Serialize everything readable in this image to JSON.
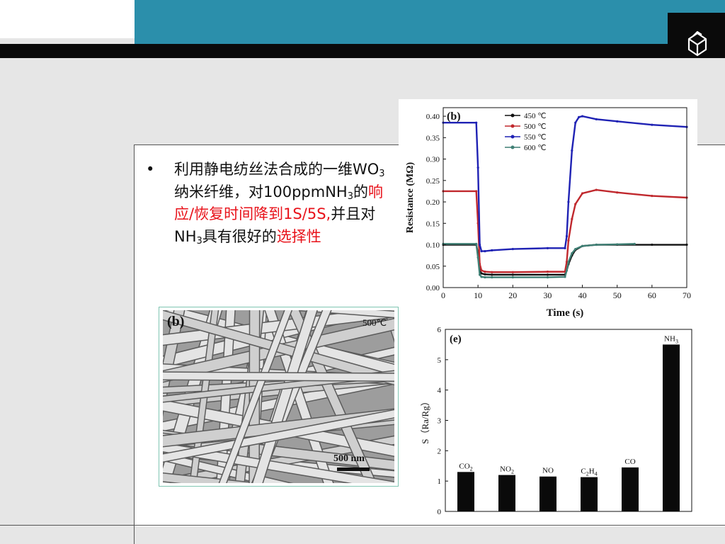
{
  "slide": {
    "bullet_symbol": "•",
    "text_parts": {
      "p1": "利用静电纺丝法合成的一维WO",
      "sub1": "3",
      "p2": "纳米纤维，对100ppmNH",
      "sub2": "3",
      "p3": "的",
      "red1": "响应/恢复时间降到1S/5S,",
      "p4": "并且对NH",
      "sub3": "3",
      "p5": "具有很好的",
      "red2": "选择性"
    }
  },
  "sem_image": {
    "panel_label": "(b)",
    "temperature": "500℃",
    "scale_bar": "500 nm"
  },
  "colors": {
    "teal": "#2b8fab",
    "red_text": "#e8121a",
    "s450": "#111111",
    "s500": "#c0282d",
    "s550": "#1f22b4",
    "s600": "#3f7f74"
  },
  "chart_data": [
    {
      "type": "line",
      "panel_label": "(b)",
      "xlabel": "Time (s)",
      "ylabel": "Resistance (MΩ)",
      "xlim": [
        0,
        70
      ],
      "ylim": [
        0,
        0.42
      ],
      "xticks": [
        "0",
        "10",
        "20",
        "30",
        "40",
        "50",
        "60",
        "70"
      ],
      "yticks": [
        "0.00",
        "0.05",
        "0.10",
        "0.15",
        "0.20",
        "0.25",
        "0.30",
        "0.35",
        "0.40"
      ],
      "legend_position": "top-center",
      "series": [
        {
          "name": "450 ℃",
          "color": "#111111",
          "x": [
            0,
            9.5,
            10,
            10.5,
            11,
            12,
            14,
            20,
            30,
            35,
            35.5,
            36,
            37,
            38,
            40,
            44,
            50,
            60,
            70
          ],
          "y": [
            0.1,
            0.1,
            0.08,
            0.04,
            0.033,
            0.031,
            0.03,
            0.03,
            0.03,
            0.03,
            0.04,
            0.055,
            0.075,
            0.088,
            0.097,
            0.1,
            0.1,
            0.1,
            0.1
          ]
        },
        {
          "name": "500 ℃",
          "color": "#c0282d",
          "x": [
            0,
            9.5,
            10,
            10.5,
            11,
            12,
            14,
            20,
            30,
            35,
            35.5,
            36,
            37,
            38,
            40,
            44,
            50,
            60,
            70
          ],
          "y": [
            0.225,
            0.225,
            0.15,
            0.055,
            0.04,
            0.037,
            0.036,
            0.036,
            0.037,
            0.037,
            0.06,
            0.11,
            0.16,
            0.195,
            0.22,
            0.228,
            0.222,
            0.214,
            0.21
          ]
        },
        {
          "name": "550 ℃",
          "color": "#1f22b4",
          "x": [
            0,
            9.5,
            10,
            10.5,
            11,
            12,
            14,
            20,
            30,
            35,
            35.5,
            36,
            37,
            38,
            39,
            40,
            44,
            50,
            60,
            70
          ],
          "y": [
            0.385,
            0.385,
            0.28,
            0.1,
            0.085,
            0.085,
            0.087,
            0.09,
            0.092,
            0.092,
            0.12,
            0.2,
            0.32,
            0.385,
            0.398,
            0.4,
            0.393,
            0.388,
            0.38,
            0.375
          ]
        },
        {
          "name": "600 ℃",
          "color": "#3f7f74",
          "x": [
            0,
            9.5,
            10,
            10.5,
            11,
            12,
            14,
            20,
            30,
            35,
            35.5,
            36,
            37,
            38,
            40,
            44,
            50,
            55
          ],
          "y": [
            0.102,
            0.102,
            0.07,
            0.03,
            0.025,
            0.024,
            0.024,
            0.024,
            0.024,
            0.025,
            0.04,
            0.06,
            0.08,
            0.09,
            0.097,
            0.1,
            0.101,
            0.102
          ]
        }
      ]
    },
    {
      "type": "bar",
      "panel_label": "(e)",
      "xlabel": "",
      "ylabel": "S（Ra/Rg）",
      "ylim": [
        0,
        6
      ],
      "yticks": [
        "0",
        "1",
        "2",
        "3",
        "4",
        "5",
        "6"
      ],
      "categories": [
        {
          "base": "CO",
          "sub": "2",
          "tail": ""
        },
        {
          "base": "NO",
          "sub": "2",
          "tail": ""
        },
        {
          "base": "NO",
          "sub": "",
          "tail": ""
        },
        {
          "base": "C",
          "sub": "2",
          "tail": "H",
          "sub2": "4"
        },
        {
          "base": "CO",
          "sub": "",
          "tail": ""
        },
        {
          "base": "NH",
          "sub": "3",
          "tail": ""
        }
      ],
      "values": [
        1.3,
        1.2,
        1.15,
        1.13,
        1.45,
        5.5
      ]
    }
  ]
}
